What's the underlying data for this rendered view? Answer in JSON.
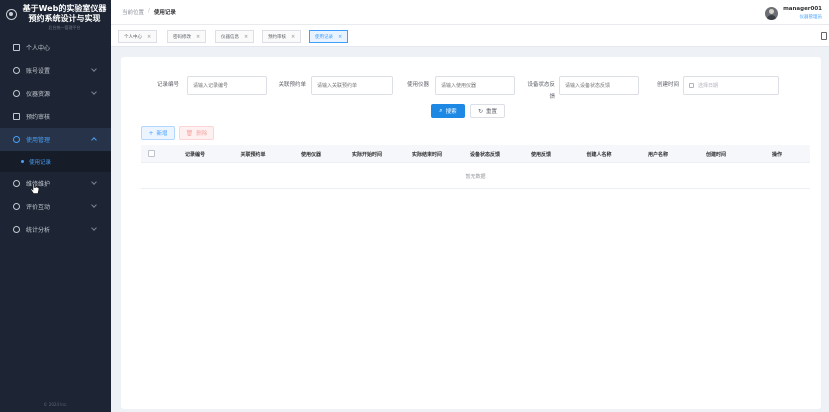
{
  "sidebar": {
    "title": "基于Web的实验室仪器预约系统设计与实现",
    "subtitle": "后台统一管理平台",
    "items": [
      {
        "label": "个人中心",
        "icon": "square-icon",
        "has_children": false
      },
      {
        "label": "账号设置",
        "icon": "circle-icon",
        "has_children": true
      },
      {
        "label": "仪器资源",
        "icon": "circle-icon",
        "has_children": true
      },
      {
        "label": "预约审核",
        "icon": "square-icon",
        "has_children": false
      },
      {
        "label": "使用管理",
        "icon": "circle-icon",
        "has_children": true,
        "expanded": true
      },
      {
        "label": "维修维护",
        "icon": "circle-icon",
        "has_children": true
      },
      {
        "label": "评价互动",
        "icon": "circle-icon",
        "has_children": true
      },
      {
        "label": "统计分析",
        "icon": "circle-icon",
        "has_children": true
      }
    ],
    "subitem": "使用记录",
    "footer": "© 2024 Inc."
  },
  "header": {
    "breadcrumb_home": "当前位置",
    "breadcrumb_sep": "/",
    "breadcrumb_current": "使用记录",
    "username": "manager001",
    "role": "仪器管理员"
  },
  "tags": [
    {
      "label": "个人中心",
      "active": false
    },
    {
      "label": "密码修改",
      "active": false
    },
    {
      "label": "仪器信息",
      "active": false
    },
    {
      "label": "预约审核",
      "active": false
    },
    {
      "label": "使用记录",
      "active": true
    }
  ],
  "tag_close": "×",
  "search": {
    "fields": [
      {
        "label": "记录编号",
        "placeholder": "请输入记录编号"
      },
      {
        "label": "关联预约单",
        "placeholder": "请输入关联预约单"
      },
      {
        "label": "使用仪器",
        "placeholder": "请输入使用仪器"
      },
      {
        "label": "设备状态反馈",
        "placeholder": "请输入设备状态反馈"
      },
      {
        "label": "创建时间",
        "placeholder": "选择日期"
      }
    ],
    "search_label": "搜索",
    "reset_label": "重置"
  },
  "actions": {
    "add_label": "新增",
    "delete_label": "删除"
  },
  "table": {
    "columns": [
      "记录编号",
      "关联预约单",
      "使用仪器",
      "实际开始时间",
      "实际结束时间",
      "设备状态反馈",
      "使用反馈",
      "创建人名称",
      "用户名称",
      "创建时间",
      "操作"
    ],
    "empty_text": "暂无数据"
  },
  "colors": {
    "sidebar_bg": "#1d2534",
    "accent": "#409eff",
    "primary_button": "#1e88e5"
  }
}
